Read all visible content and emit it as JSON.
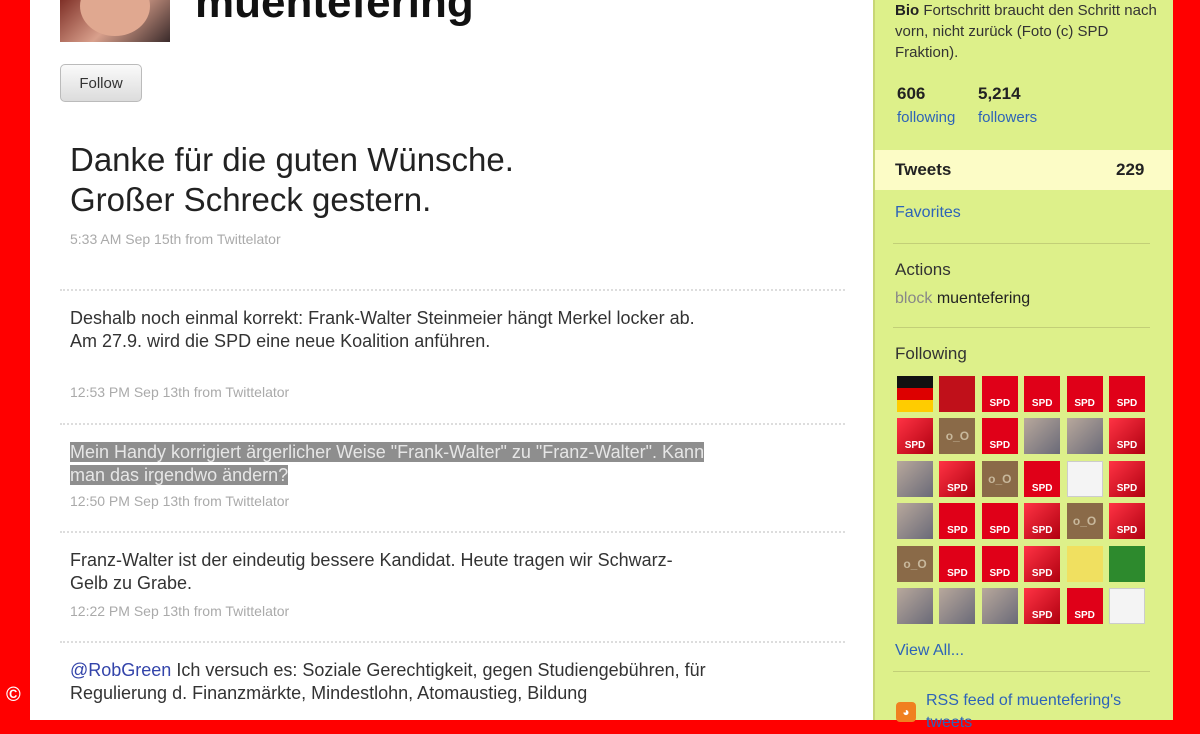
{
  "profile": {
    "username": "muentefering",
    "follow_label": "Follow"
  },
  "featured_tweet": {
    "line1": "Danke für die guten Wünsche.",
    "line2": "Großer Schreck gestern.",
    "meta": "5:33 AM Sep 15th from Twittelator"
  },
  "tweets": [
    {
      "text": "Deshalb noch einmal korrekt: Frank-Walter Steinmeier hängt Merkel locker ab. Am 27.9. wird die SPD eine neue Koalition anführen.",
      "meta": "12:53 PM Sep 13th from Twittelator"
    },
    {
      "text": "Mein Handy korrigiert ärgerlicher Weise \"Frank-Walter\" zu \"Franz-Walter\". Kann man das irgendwo ändern?",
      "meta": "12:50 PM Sep 13th from Twittelator"
    },
    {
      "text": "Franz-Walter ist der eindeutig bessere Kandidat. Heute tragen wir Schwarz-Gelb zu Grabe.",
      "meta": "12:22 PM Sep 13th from Twittelator"
    },
    {
      "mention": "@RobGreen",
      "text": " Ich versuch es: Soziale Gerechtigkeit, gegen Studiengebühren, für Regulierung d. Finanzmärkte, Mindestlohn, Atomaustieg, Bildung"
    }
  ],
  "sidebar": {
    "bio_label": "Bio",
    "bio_text": "Fortschritt braucht den Schritt nach vorn, nicht zurück (Foto (c) SPD Fraktion).",
    "following_count": "606",
    "following_label": "following",
    "followers_count": "5,214",
    "followers_label": "followers",
    "tweets_label": "Tweets",
    "tweets_count": "229",
    "favorites_label": "Favorites",
    "actions_label": "Actions",
    "block_label": "block",
    "block_user": "muentefering",
    "following_heading": "Following",
    "following_grid": [
      [
        "flag",
        "dark",
        "spd",
        "spd",
        "spd",
        "spd"
      ],
      [
        "spd3d",
        "egg",
        "spd",
        "photo",
        "photo",
        "spd3d"
      ],
      [
        "photo",
        "spd3d",
        "egg",
        "spd",
        "white",
        "spd3d"
      ],
      [
        "photo",
        "spd",
        "spd",
        "spd3d",
        "egg",
        "spd3d"
      ],
      [
        "egg",
        "spd",
        "spd",
        "spd3d",
        "sign",
        "green"
      ],
      [
        "photo",
        "photo",
        "photo",
        "spd3d",
        "spd",
        "white"
      ]
    ],
    "spd_text": "SPD",
    "egg_text": "o_O",
    "view_all_label": "View All...",
    "rss_label": "RSS feed of muentefering's tweets"
  },
  "copyright_symbol": "©"
}
